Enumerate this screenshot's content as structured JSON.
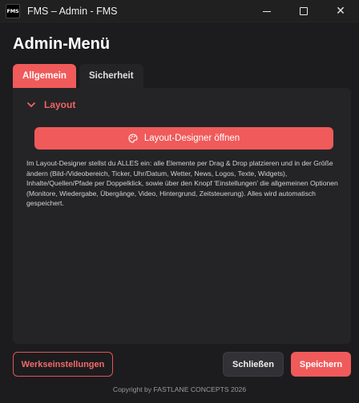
{
  "window": {
    "icon_text": "FMS",
    "title": "FMS – Admin - FMS",
    "controls": {
      "minimize_icon": "minimize-icon",
      "maximize_icon": "maximize-icon",
      "close_icon": "close-icon",
      "close_glyph": "✕"
    }
  },
  "page": {
    "title": "Admin-Menü"
  },
  "tabs": [
    {
      "label": "Allgemein",
      "active": true
    },
    {
      "label": "Sicherheit",
      "active": false
    }
  ],
  "section": {
    "title": "Layout",
    "expanded": true,
    "designer_button": {
      "label": "Layout-Designer öffnen",
      "icon": "palette-icon"
    },
    "help_text": "Im Layout-Designer stellst du ALLES ein: alle Elemente per Drag & Drop platzieren und in der Größe ändern (Bild-/Videobereich, Ticker, Uhr/Datum, Wetter, News, Logos, Texte, Widgets), Inhalte/Quellen/Pfade per Doppelklick, sowie über den Knopf 'Einstellungen' die allgemeinen Optionen (Monitore, Wiedergabe, Übergänge, Video, Hintergrund, Zeitsteuerung). Alles wird automatisch gespeichert."
  },
  "footer": {
    "reset_label": "Werkseinstellungen",
    "close_label": "Schließen",
    "save_label": "Speichern",
    "copyright": "Copyright by FASTLANE CONCEPTS 2026"
  },
  "colors": {
    "accent": "#f05a5a",
    "background": "#1c1c1e",
    "panel": "#242427"
  }
}
